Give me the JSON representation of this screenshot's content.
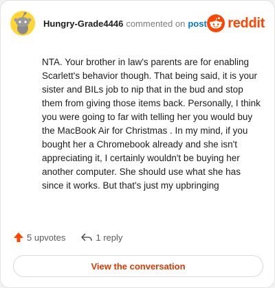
{
  "comment": {
    "author": "Hungry-Grade4446",
    "action_text": "commented on",
    "target_link": "post",
    "brand": "reddit",
    "body": "NTA. Your brother in law's parents are for enabling Scarlett's behavior though. That being said, it is your sister and BILs job to nip that in the bud and stop them from giving those items back. Personally, I think you were going to far with telling her you would buy the MacBook Air for Christmas . In my mind, if you bought her a Chromebook already and she isn't appreciating it, I certainly wouldn't be buying her another computer. She should use what she has since it works. But that's just my upbringing"
  },
  "footer": {
    "upvotes": "5 upvotes",
    "replies": "1 reply"
  },
  "cta": {
    "label": "View the conversation"
  },
  "colors": {
    "brand": "#ff4500",
    "link": "#0079d3",
    "cta_text": "#d93a00",
    "avatar_bg": "#ffd635"
  },
  "icons": {
    "avatar": "snoo-avatar-icon",
    "brand": "reddit-logo-icon",
    "upvote": "upvote-arrow-icon",
    "reply": "reply-arrow-icon"
  }
}
